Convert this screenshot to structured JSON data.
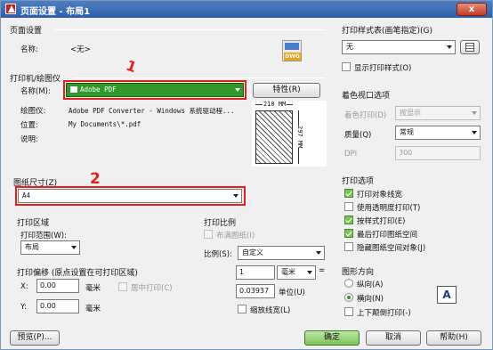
{
  "window": {
    "title": "页面设置 - 布局1",
    "close": "x"
  },
  "page_setup": {
    "title": "页面设置",
    "name_label": "名称:",
    "name_value": "<无>",
    "dwg_icon": "DWG"
  },
  "printer": {
    "title": "打印机/绘图仪",
    "name_label": "名称(M):",
    "selected": "Adobe PDF",
    "properties_btn": "特性(R)",
    "plotter_label": "绘图仪:",
    "plotter_value": "Adobe PDF Converter - Windows 系统驱动程...",
    "location_label": "位置:",
    "location_value": "My Documents\\*.pdf",
    "desc_label": "说明:",
    "dim_width": "210 MM",
    "dim_height": "297 MM"
  },
  "paper": {
    "title": "图纸尺寸(Z)",
    "selected": "A4"
  },
  "print_area": {
    "title": "打印区域",
    "range_label": "打印范围(W):",
    "range_value": "布局"
  },
  "offset": {
    "title": "打印偏移 (原点设置在可打印区域)",
    "x_label": "X:",
    "x_value": "0.00",
    "y_label": "Y:",
    "y_value": "0.00",
    "unit": "毫米",
    "center_label": "居中打印(C)"
  },
  "scale": {
    "title": "打印比例",
    "fit_label": "布满图纸(I)",
    "ratio_label": "比例(S):",
    "ratio_value": "自定义",
    "val1": "1",
    "unit1": "毫米",
    "eq": "=",
    "val2": "0.03937",
    "unit2": "单位(U)",
    "lineweight_label": "缩放线宽(L)"
  },
  "style_table": {
    "title": "打印样式表(画笔指定)(G)",
    "selected": "无",
    "show_label": "显示打印样式(O)"
  },
  "shaded": {
    "title": "着色视口选项",
    "shade_label": "着色打印(D)",
    "shade_value": "按显示",
    "quality_label": "质量(Q)",
    "quality_value": "常规",
    "dpi_label": "DPI",
    "dpi_value": "300"
  },
  "options": {
    "title": "打印选项",
    "items": [
      {
        "label": "打印对象线宽",
        "checked": true
      },
      {
        "label": "使用透明度打印(T)",
        "checked": false
      },
      {
        "label": "按样式打印(E)",
        "checked": true
      },
      {
        "label": "最后打印图纸空间",
        "checked": true
      },
      {
        "label": "隐藏图纸空间对象(J)",
        "checked": false
      }
    ]
  },
  "orientation": {
    "title": "图形方向",
    "portrait": "纵向(A)",
    "landscape": "横向(N)",
    "upside": "上下颠倒打印(-)",
    "icon_letter": "A"
  },
  "footer": {
    "preview": "预览(P)...",
    "ok": "确定",
    "cancel": "取消",
    "help": "帮助(H)"
  },
  "annotations": {
    "a1": "1",
    "a2": "2"
  }
}
